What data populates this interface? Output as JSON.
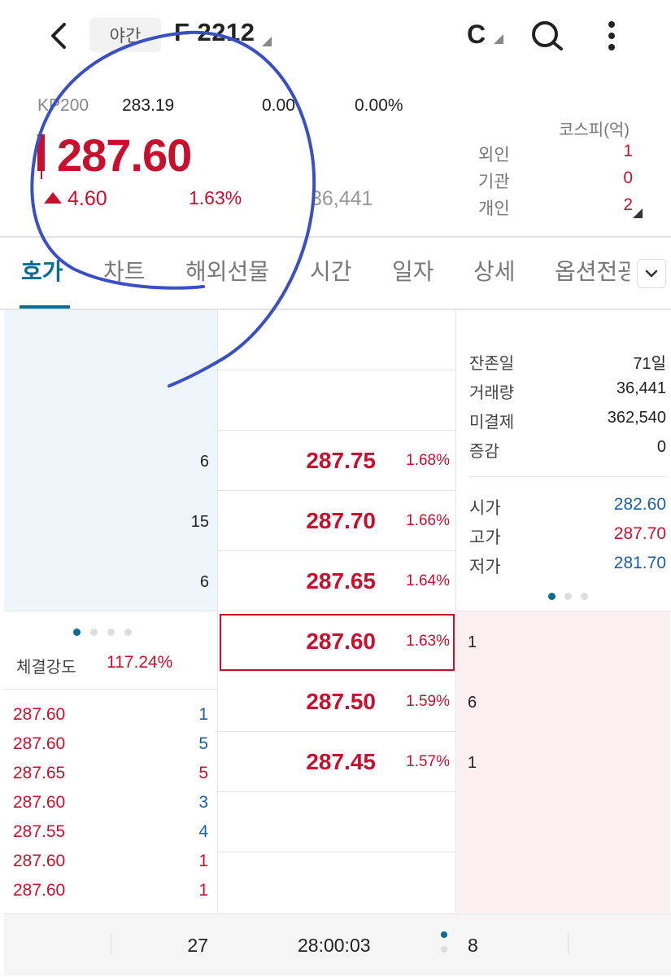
{
  "header": {
    "session_badge": "야간",
    "code": "F 2212",
    "c_label": "C"
  },
  "summary": {
    "index_name": "KP200",
    "index_value": "283.19",
    "index_change": "0.00",
    "index_change_pct": "0.00%",
    "price": "287.60",
    "change": "4.60",
    "change_pct": "1.63%",
    "volume_partial": "36,441",
    "investor_title": "코스피(억)",
    "investors": [
      {
        "label": "외인",
        "value": "1"
      },
      {
        "label": "기관",
        "value": "0"
      },
      {
        "label": "개인",
        "value": "2"
      }
    ]
  },
  "tabs": [
    "호가",
    "차트",
    "해외선물",
    "시간",
    "일자",
    "상세",
    "옵션전광"
  ],
  "orderbook": {
    "asks": [
      {
        "qty": "6",
        "price": "287.75",
        "pct": "1.68%"
      },
      {
        "qty": "15",
        "price": "287.70",
        "pct": "1.66%"
      },
      {
        "qty": "6",
        "price": "287.65",
        "pct": "1.64%"
      }
    ],
    "bids": [
      {
        "qty": "1",
        "price": "287.60",
        "pct": "1.63%"
      },
      {
        "qty": "6",
        "price": "287.50",
        "pct": "1.59%"
      },
      {
        "qty": "1",
        "price": "287.45",
        "pct": "1.57%"
      }
    ],
    "strength_label": "체결강도",
    "strength_value": "117.24%",
    "ticks": [
      {
        "price": "287.60",
        "qty": "1",
        "qty_color": "blue"
      },
      {
        "price": "287.60",
        "qty": "5",
        "qty_color": "blue"
      },
      {
        "price": "287.65",
        "qty": "5",
        "qty_color": "red"
      },
      {
        "price": "287.60",
        "qty": "3",
        "qty_color": "blue"
      },
      {
        "price": "287.55",
        "qty": "4",
        "qty_color": "blue"
      },
      {
        "price": "287.60",
        "qty": "1",
        "qty_color": "red"
      },
      {
        "price": "287.60",
        "qty": "1",
        "qty_color": "red"
      }
    ]
  },
  "info": {
    "rows": [
      {
        "label": "잔존일",
        "value": "71일"
      },
      {
        "label": "거래량",
        "value": "36,441"
      },
      {
        "label": "미결제",
        "value": "362,540"
      },
      {
        "label": "증감",
        "value": "0"
      }
    ],
    "prices": [
      {
        "label": "시가",
        "value": "282.60",
        "color": "blue"
      },
      {
        "label": "고가",
        "value": "287.70",
        "color": "red"
      },
      {
        "label": "저가",
        "value": "281.70",
        "color": "blue"
      }
    ]
  },
  "footer": {
    "ask_total": "27",
    "time": "28:00:03",
    "bid_total": "8"
  }
}
